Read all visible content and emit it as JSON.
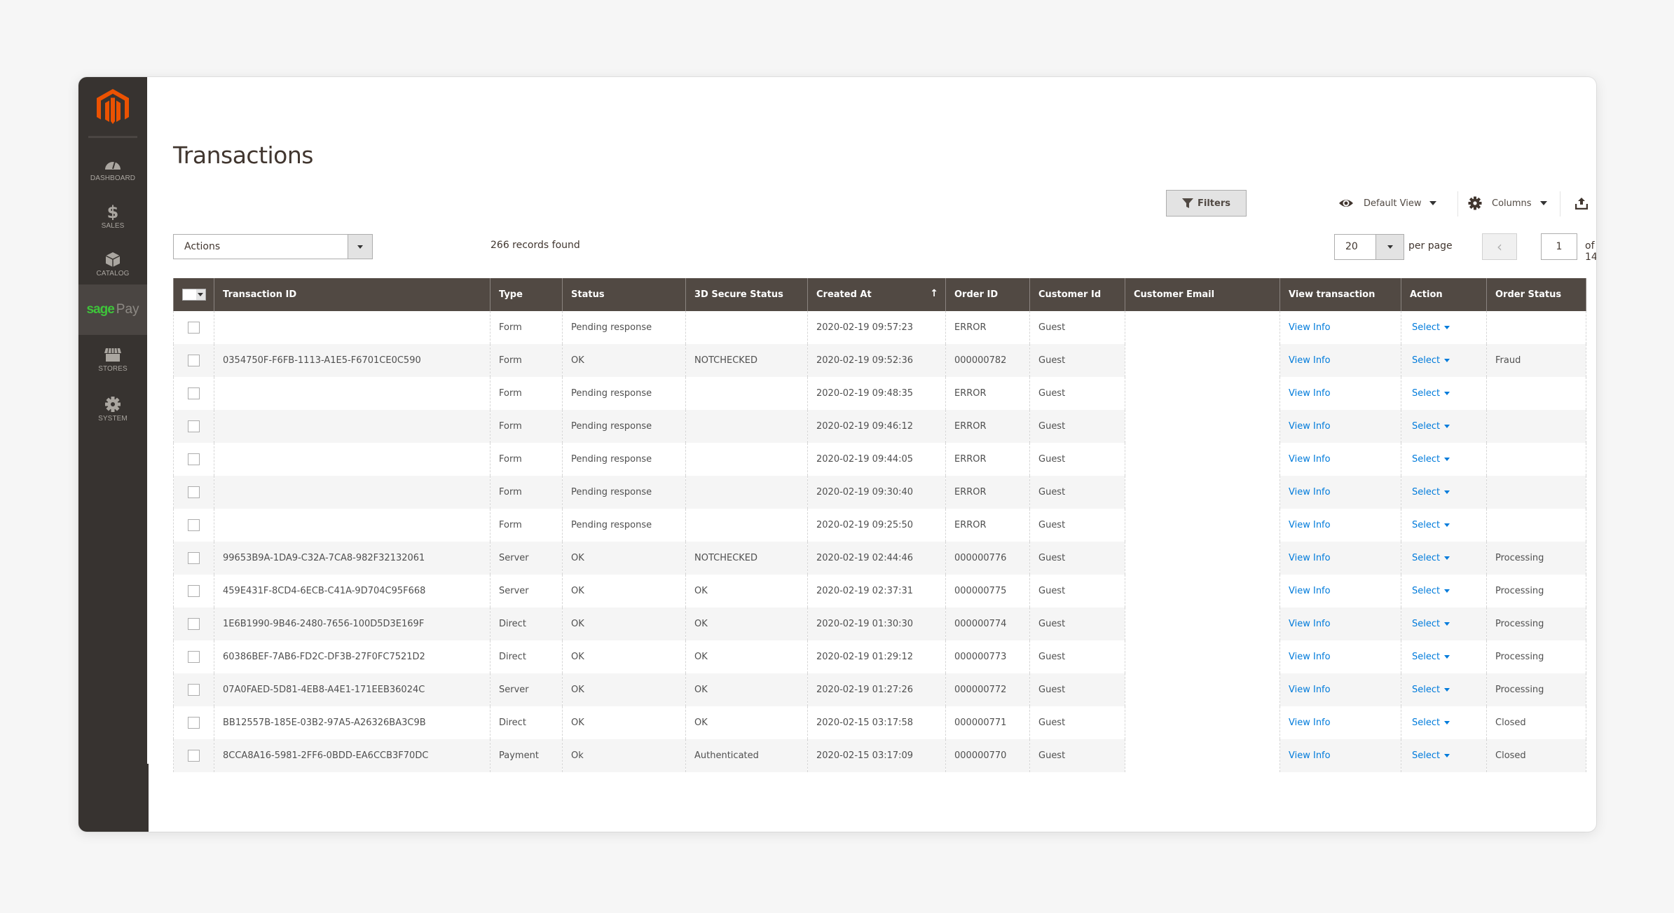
{
  "sidebar": {
    "logo": "magento-logo",
    "items": [
      {
        "label": "DASHBOARD",
        "icon": "dashboard-icon"
      },
      {
        "label": "SALES",
        "icon": "dollar-icon"
      },
      {
        "label": "CATALOG",
        "icon": "box-icon"
      },
      {
        "label_sage": "sage",
        "label_pay": "Pay",
        "icon": "sagepay-logo",
        "active": true
      },
      {
        "label": "STORES",
        "icon": "store-icon"
      },
      {
        "label": "SYSTEM",
        "icon": "gear-icon"
      }
    ]
  },
  "page": {
    "title": "Transactions"
  },
  "toolbar": {
    "filters_label": "Filters",
    "view_label": "Default View",
    "columns_label": "Columns",
    "export_label": "Export"
  },
  "actions": {
    "select_value": "Actions",
    "records_found": "266 records found"
  },
  "pagination": {
    "per_page_value": "20",
    "per_page_label": "per page",
    "current_page": "1",
    "total_pages_label": "of 14",
    "prev_glyph": "‹",
    "next_glyph": "›"
  },
  "grid": {
    "columns": [
      "Transaction ID",
      "Type",
      "Status",
      "3D Secure Status",
      "Created At",
      "Order ID",
      "Customer Id",
      "Customer Email",
      "View transaction",
      "Action",
      "Order Status"
    ],
    "sorted_column": "Created At",
    "sort_glyph": "↑",
    "view_link_label": "View Info",
    "action_label": "Select",
    "rows": [
      {
        "transaction_id": "",
        "type": "Form",
        "status": "Pending response",
        "secure_status": "",
        "created_at": "2020-02-19 09:57:23",
        "order_id": "ERROR",
        "customer_id": "Guest",
        "customer_email": "",
        "order_status": ""
      },
      {
        "transaction_id": "0354750F-F6FB-1113-A1E5-F6701CE0C590",
        "type": "Form",
        "status": "OK",
        "secure_status": "NOTCHECKED",
        "created_at": "2020-02-19 09:52:36",
        "order_id": "000000782",
        "customer_id": "Guest",
        "customer_email": "",
        "order_status": "Fraud"
      },
      {
        "transaction_id": "",
        "type": "Form",
        "status": "Pending response",
        "secure_status": "",
        "created_at": "2020-02-19 09:48:35",
        "order_id": "ERROR",
        "customer_id": "Guest",
        "customer_email": "",
        "order_status": ""
      },
      {
        "transaction_id": "",
        "type": "Form",
        "status": "Pending response",
        "secure_status": "",
        "created_at": "2020-02-19 09:46:12",
        "order_id": "ERROR",
        "customer_id": "Guest",
        "customer_email": "",
        "order_status": ""
      },
      {
        "transaction_id": "",
        "type": "Form",
        "status": "Pending response",
        "secure_status": "",
        "created_at": "2020-02-19 09:44:05",
        "order_id": "ERROR",
        "customer_id": "Guest",
        "customer_email": "",
        "order_status": ""
      },
      {
        "transaction_id": "",
        "type": "Form",
        "status": "Pending response",
        "secure_status": "",
        "created_at": "2020-02-19 09:30:40",
        "order_id": "ERROR",
        "customer_id": "Guest",
        "customer_email": "",
        "order_status": ""
      },
      {
        "transaction_id": "",
        "type": "Form",
        "status": "Pending response",
        "secure_status": "",
        "created_at": "2020-02-19 09:25:50",
        "order_id": "ERROR",
        "customer_id": "Guest",
        "customer_email": "",
        "order_status": ""
      },
      {
        "transaction_id": "99653B9A-1DA9-C32A-7CA8-982F32132061",
        "type": "Server",
        "status": "OK",
        "secure_status": "NOTCHECKED",
        "created_at": "2020-02-19 02:44:46",
        "order_id": "000000776",
        "customer_id": "Guest",
        "customer_email": "",
        "order_status": "Processing"
      },
      {
        "transaction_id": "459E431F-8CD4-6ECB-C41A-9D704C95F668",
        "type": "Server",
        "status": "OK",
        "secure_status": "OK",
        "created_at": "2020-02-19 02:37:31",
        "order_id": "000000775",
        "customer_id": "Guest",
        "customer_email": "",
        "order_status": "Processing"
      },
      {
        "transaction_id": "1E6B1990-9B46-2480-7656-100D5D3E169F",
        "type": "Direct",
        "status": "OK",
        "secure_status": "OK",
        "created_at": "2020-02-19 01:30:30",
        "order_id": "000000774",
        "customer_id": "Guest",
        "customer_email": "",
        "order_status": "Processing"
      },
      {
        "transaction_id": "60386BEF-7AB6-FD2C-DF3B-27F0FC7521D2",
        "type": "Direct",
        "status": "OK",
        "secure_status": "OK",
        "created_at": "2020-02-19 01:29:12",
        "order_id": "000000773",
        "customer_id": "Guest",
        "customer_email": "",
        "order_status": "Processing"
      },
      {
        "transaction_id": "07A0FAED-5D81-4EB8-A4E1-171EEB36024C",
        "type": "Server",
        "status": "OK",
        "secure_status": "OK",
        "created_at": "2020-02-19 01:27:26",
        "order_id": "000000772",
        "customer_id": "Guest",
        "customer_email": "",
        "order_status": "Processing"
      },
      {
        "transaction_id": "BB12557B-185E-03B2-97A5-A26326BA3C9B",
        "type": "Direct",
        "status": "OK",
        "secure_status": "OK",
        "created_at": "2020-02-15 03:17:58",
        "order_id": "000000771",
        "customer_id": "Guest",
        "customer_email": "",
        "order_status": "Closed"
      },
      {
        "transaction_id": "8CCA8A16-5981-2FF6-0BDD-EA6CCB3F70DC",
        "type": "Payment",
        "status": "Ok",
        "secure_status": "Authenticated",
        "created_at": "2020-02-15 03:17:09",
        "order_id": "000000770",
        "customer_id": "Guest",
        "customer_email": "",
        "order_status": "Closed"
      }
    ]
  },
  "colors": {
    "sidebar_bg": "#373330",
    "header_bg": "#514943",
    "brand_orange": "#eb5202",
    "sage_green": "#3ec43a",
    "link_blue": "#007bdb"
  }
}
